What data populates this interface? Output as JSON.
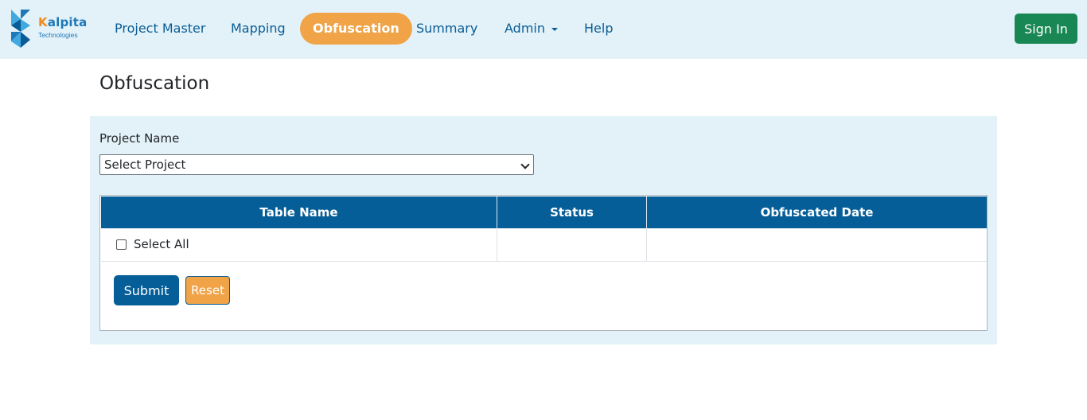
{
  "brand": {
    "name_first": "K",
    "name_rest": "alpita",
    "subtitle": "Technologies",
    "colors": {
      "orange": "#f28a1e",
      "blue": "#1f78b7"
    }
  },
  "nav": {
    "items": [
      {
        "label": "Project Master",
        "active": false
      },
      {
        "label": "Mapping",
        "active": false
      },
      {
        "label": "Obfuscation",
        "active": true
      },
      {
        "label": "Summary",
        "active": false
      },
      {
        "label": "Admin",
        "active": false,
        "dropdown": true
      },
      {
        "label": "Help",
        "active": false
      }
    ],
    "sign_in_label": "Sign In"
  },
  "page": {
    "title": "Obfuscation"
  },
  "form": {
    "project_label": "Project Name",
    "project_select_value": "Select Project"
  },
  "table": {
    "headers": [
      "Table Name",
      "Status",
      "Obfuscated Date"
    ],
    "select_all_label": "Select All"
  },
  "actions": {
    "submit_label": "Submit",
    "reset_label": "Reset"
  },
  "colors": {
    "nav_bg": "#e3f2f8",
    "primary": "#055e97",
    "accent": "#f0a347",
    "success": "#198754"
  }
}
